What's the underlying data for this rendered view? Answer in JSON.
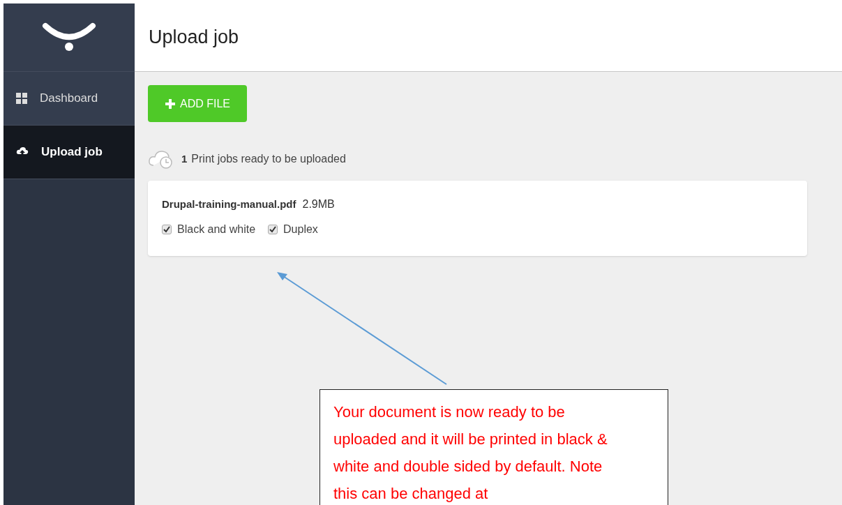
{
  "sidebar": {
    "items": [
      {
        "label": "Dashboard",
        "kind": "grid",
        "selected": false
      },
      {
        "label": "Upload job",
        "kind": "upload",
        "selected": true
      }
    ]
  },
  "header": {
    "title": "Upload job"
  },
  "add_button": {
    "label": "ADD FILE"
  },
  "status": {
    "count": "1",
    "text": "Print jobs ready to be uploaded"
  },
  "jobs": [
    {
      "filename": "Drupal-training-manual.pdf",
      "size": "2.9MB",
      "options": [
        {
          "label": "Black and white",
          "checked": true
        },
        {
          "label": "Duplex",
          "checked": true
        }
      ]
    }
  ],
  "callout": {
    "text": "Your document is now ready to be uploaded and it will be printed in black & white and double sided by default. Note this can be changed at"
  }
}
